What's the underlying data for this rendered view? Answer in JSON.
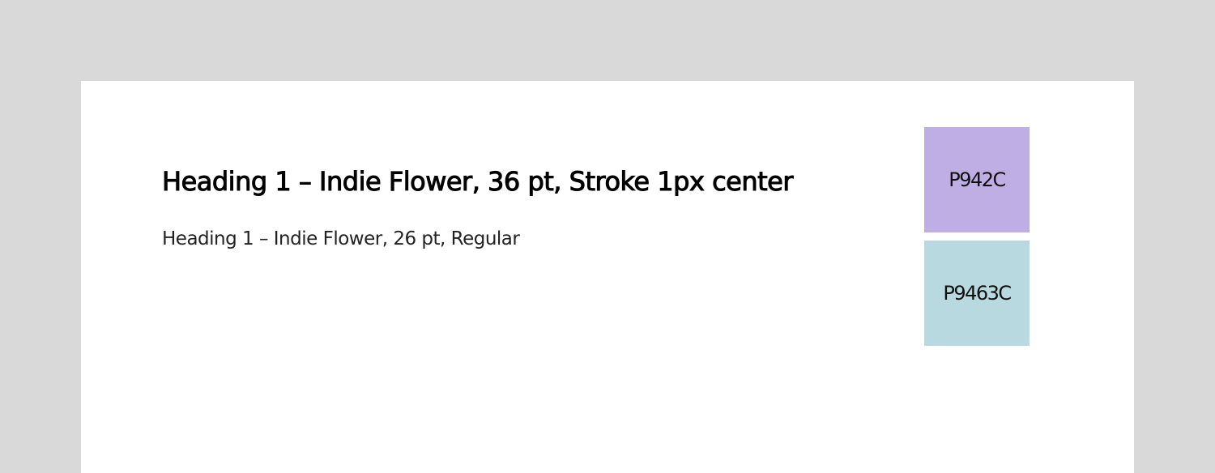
{
  "headings": {
    "stroke": "Heading 1 – Indie Flower, 36 pt, Stroke 1px center",
    "regular": "Heading 1 – Indie Flower, 26 pt, Regular"
  },
  "swatches": [
    {
      "label": "P942C",
      "color": "#bfaee4"
    },
    {
      "label": "P9463C",
      "color": "#b8d9df"
    }
  ]
}
